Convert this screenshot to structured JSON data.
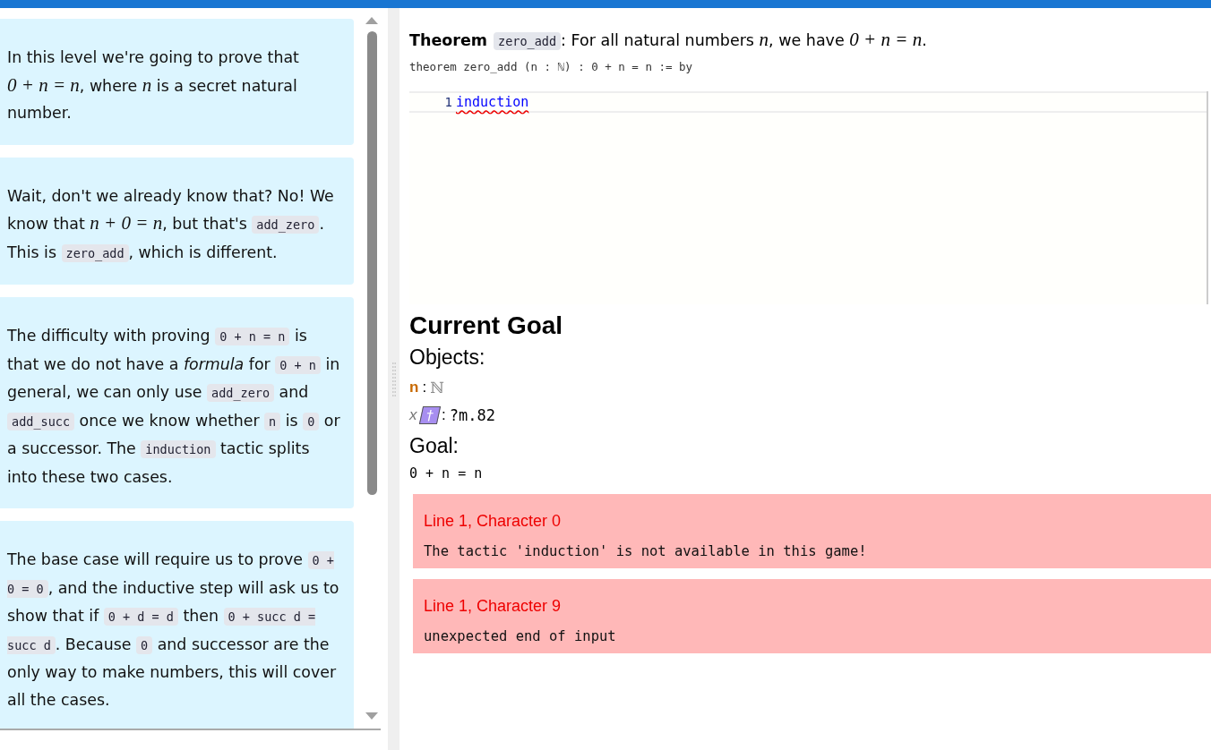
{
  "intro_cards": [
    {
      "segments": [
        {
          "kind": "text",
          "text": "In this level we're going to prove that "
        },
        {
          "kind": "math",
          "text": "0 + n = n"
        },
        {
          "kind": "text",
          "text": ", where "
        },
        {
          "kind": "math",
          "text": "n"
        },
        {
          "kind": "text",
          "text": " is a secret natural number."
        }
      ]
    },
    {
      "segments": [
        {
          "kind": "text",
          "text": "Wait, don't we already know that? No! We know that "
        },
        {
          "kind": "math",
          "text": "n + 0 = n"
        },
        {
          "kind": "text",
          "text": ", but that's "
        },
        {
          "kind": "code",
          "text": "add_zero"
        },
        {
          "kind": "text",
          "text": ". This is "
        },
        {
          "kind": "code",
          "text": "zero_add"
        },
        {
          "kind": "text",
          "text": ", which is different."
        }
      ]
    },
    {
      "segments": [
        {
          "kind": "text",
          "text": "The difficulty with proving "
        },
        {
          "kind": "code",
          "text": "0 + n = n"
        },
        {
          "kind": "text",
          "text": " is that we do not have a "
        },
        {
          "kind": "em",
          "text": "formula"
        },
        {
          "kind": "text",
          "text": " for "
        },
        {
          "kind": "code",
          "text": "0 + n"
        },
        {
          "kind": "text",
          "text": " in general, we can only use "
        },
        {
          "kind": "code",
          "text": "add_zero"
        },
        {
          "kind": "text",
          "text": " and "
        },
        {
          "kind": "code",
          "text": "add_succ"
        },
        {
          "kind": "text",
          "text": " once we know whether "
        },
        {
          "kind": "code",
          "text": "n"
        },
        {
          "kind": "text",
          "text": " is "
        },
        {
          "kind": "code",
          "text": "0"
        },
        {
          "kind": "text",
          "text": " or a successor. The "
        },
        {
          "kind": "code",
          "text": "induction"
        },
        {
          "kind": "text",
          "text": " tactic splits into these two cases."
        }
      ]
    },
    {
      "segments": [
        {
          "kind": "text",
          "text": "The base case will require us to prove "
        },
        {
          "kind": "code",
          "text": "0 + 0 = 0"
        },
        {
          "kind": "text",
          "text": ", and the inductive step will ask us to show that if "
        },
        {
          "kind": "code",
          "text": "0 + d = d"
        },
        {
          "kind": "text",
          "text": " then "
        },
        {
          "kind": "code",
          "text": "0 + succ d = succ d"
        },
        {
          "kind": "text",
          "text": ". Because "
        },
        {
          "kind": "code",
          "text": "0"
        },
        {
          "kind": "text",
          "text": " and successor are the only way to make numbers, this will cover all the cases."
        }
      ]
    }
  ],
  "theorem": {
    "segments": [
      {
        "kind": "strong",
        "text": "Theorem"
      },
      {
        "kind": "code",
        "text": "zero_add"
      },
      {
        "kind": "text",
        "text": ": For all natural numbers "
      },
      {
        "kind": "math",
        "text": "n"
      },
      {
        "kind": "text",
        "text": ", we have "
      },
      {
        "kind": "math",
        "text": "0 + n = n"
      },
      {
        "kind": "text",
        "text": "."
      }
    ]
  },
  "signature": "theorem zero_add (n : ℕ) : 0 + n = n := by",
  "editor": {
    "lines": [
      {
        "number": "1",
        "text": "induction",
        "error": true
      }
    ]
  },
  "goal_panel": {
    "title": "Current Goal",
    "objects_heading": "Objects:",
    "objects": [
      {
        "kind": "variable",
        "name": "n",
        "separator": ":",
        "type": "ℕ"
      },
      {
        "kind": "metavariable",
        "name": "x",
        "badge": "†",
        "separator": ":",
        "type": "?m.82"
      }
    ],
    "goal_heading": "Goal:",
    "goal": "0 + n = n"
  },
  "messages": [
    {
      "kind": "error",
      "position": "Line 1, Character 0",
      "text": "The tactic 'induction' is not available in this game!"
    },
    {
      "kind": "error",
      "position": "Line 1, Character 9",
      "text": "unexpected end of input"
    }
  ]
}
